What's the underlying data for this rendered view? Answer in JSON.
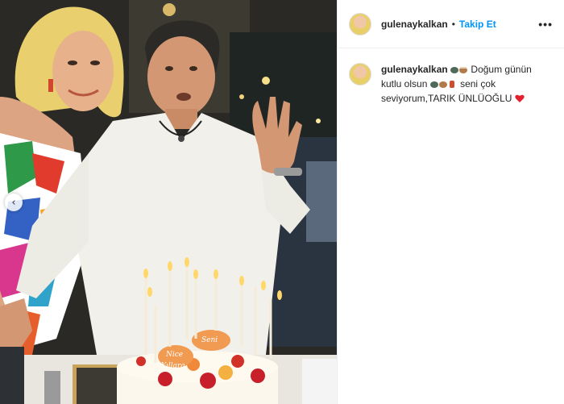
{
  "post": {
    "username": "gulenaykalkan",
    "follow_label": "Takip Et",
    "separator": "•",
    "more_label": "•••"
  },
  "caption": {
    "username": "gulenaykalkan",
    "part1": "Doğum günün kutlu olsun",
    "part2": "seni çok seviyorum,TARIK ÜNLÜOĞLU"
  },
  "photo": {
    "cake_text_1": "Nice",
    "cake_text_2": "Yıllara",
    "cake_text_3": "Seni",
    "nav_prev_icon": "‹"
  }
}
